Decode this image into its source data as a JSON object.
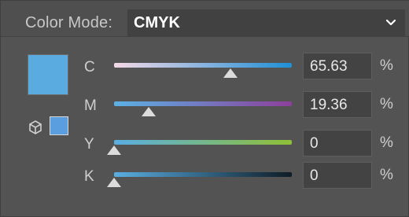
{
  "header": {
    "mode_label": "Color Mode:",
    "mode_value": "CMYK"
  },
  "colors": {
    "main_swatch": "#5aace0",
    "small_swatch": "#5b9ee0",
    "c_track_start": "#f4d8e6",
    "c_track_end": "#1f8fd6",
    "m_track_start": "#5bb2e6",
    "m_track_end": "#8d3f9a",
    "y_track_start": "#5aaee2",
    "y_track_end": "#8fbf36",
    "k_track_start": "#5aaee2",
    "k_track_end": "#0d1c26"
  },
  "icons": {
    "gamut": "cube-icon",
    "chevron": "chevron-down-icon"
  },
  "sliders": [
    {
      "channel": "C",
      "value": "65.63",
      "unit": "%",
      "level": 0.6563
    },
    {
      "channel": "M",
      "value": "19.36",
      "unit": "%",
      "level": 0.1936
    },
    {
      "channel": "Y",
      "value": "0",
      "unit": "%",
      "level": 0
    },
    {
      "channel": "K",
      "value": "0",
      "unit": "%",
      "level": 0
    }
  ]
}
